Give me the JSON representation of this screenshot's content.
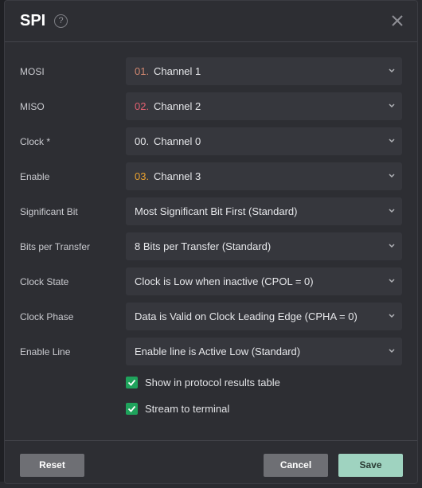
{
  "dialog": {
    "title": "SPI",
    "help_icon": "question-circle-icon",
    "close_icon": "close-icon"
  },
  "colors": {
    "channel_1": "#d08770",
    "channel_2": "#e06070",
    "channel_0": "#e6e7ea",
    "channel_3": "#e8a030",
    "checkbox": "#1fa35c",
    "save_button": "#9fd3c0"
  },
  "fields": {
    "mosi": {
      "label": "MOSI",
      "num": "01.",
      "value": "Channel 1"
    },
    "miso": {
      "label": "MISO",
      "num": "02.",
      "value": "Channel 2"
    },
    "clock": {
      "label": "Clock *",
      "num": "00.",
      "value": "Channel 0"
    },
    "enable": {
      "label": "Enable",
      "num": "03.",
      "value": "Channel 3"
    },
    "significant_bit": {
      "label": "Significant Bit",
      "value": "Most Significant Bit First (Standard)"
    },
    "bits_per_transfer": {
      "label": "Bits per Transfer",
      "value": "8 Bits per Transfer (Standard)"
    },
    "clock_state": {
      "label": "Clock State",
      "value": "Clock is Low when inactive (CPOL = 0)"
    },
    "clock_phase": {
      "label": "Clock Phase",
      "value": "Data is Valid on Clock Leading Edge (CPHA = 0)"
    },
    "enable_line": {
      "label": "Enable Line",
      "value": "Enable line is Active Low (Standard)"
    }
  },
  "options": {
    "show_in_table": {
      "label": "Show in protocol results table",
      "checked": true
    },
    "stream_to_terminal": {
      "label": "Stream to terminal",
      "checked": true
    }
  },
  "buttons": {
    "reset": "Reset",
    "cancel": "Cancel",
    "save": "Save"
  }
}
